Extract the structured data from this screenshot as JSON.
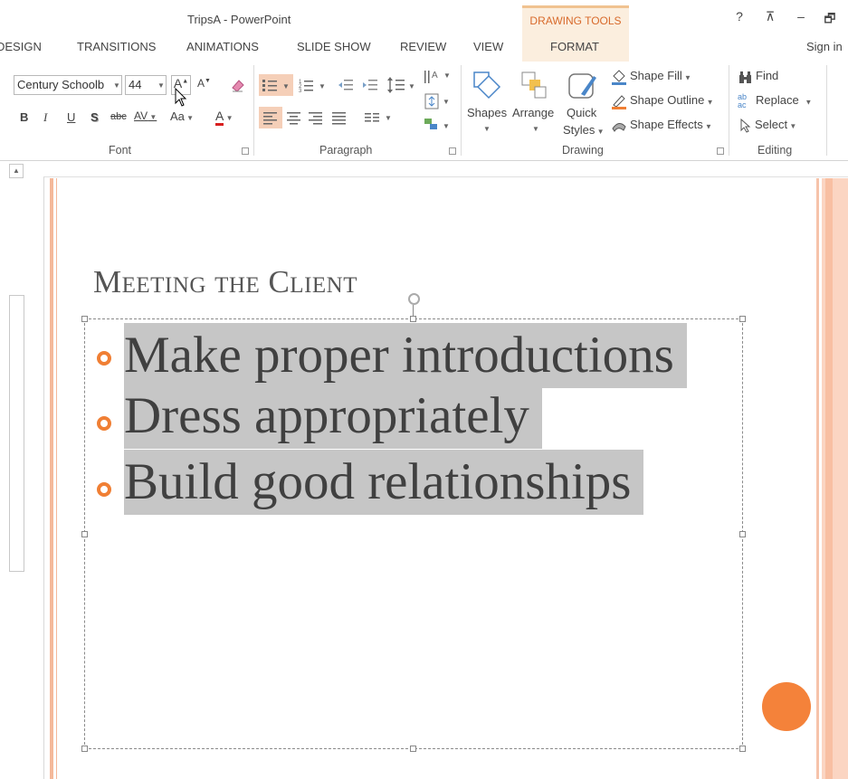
{
  "window": {
    "doc_title": "TripsA - PowerPoint",
    "context_tab": "DRAWING TOOLS",
    "help": "?",
    "ribbon_opt": "⊼",
    "minimize": "–",
    "restore": "🗗"
  },
  "tabs": [
    {
      "label": "DESIGN"
    },
    {
      "label": "TRANSITIONS"
    },
    {
      "label": "ANIMATIONS"
    },
    {
      "label": "SLIDE SHOW"
    },
    {
      "label": "REVIEW"
    },
    {
      "label": "VIEW"
    },
    {
      "label": "FORMAT"
    }
  ],
  "sign_in": "Sign in",
  "font": {
    "name": "Century Schoolb",
    "size": "44",
    "grow": "A",
    "shrink": "A",
    "bold": "B",
    "italic": "I",
    "underline": "U",
    "shadow": "S",
    "strike": "abc",
    "spacing": "AV",
    "case": "Aa",
    "color": "A",
    "label": "Font"
  },
  "paragraph": {
    "label": "Paragraph"
  },
  "drawing": {
    "shapes": "Shapes",
    "arrange": "Arrange",
    "quick": "Quick",
    "styles": "Styles",
    "shape_fill": "Shape Fill",
    "shape_outline": "Shape Outline",
    "shape_effects": "Shape Effects",
    "label": "Drawing"
  },
  "editing": {
    "find": "Find",
    "replace": "Replace",
    "select": "Select",
    "label": "Editing"
  },
  "slide": {
    "title": "Meeting the Client",
    "bullets": [
      "Make proper introductions",
      "Dress appropriately",
      "Build good relationships"
    ]
  },
  "colors": {
    "accent": "#f07f34",
    "selection_highlight": "#c6c6c6",
    "context_tab": "#d86a2b"
  }
}
